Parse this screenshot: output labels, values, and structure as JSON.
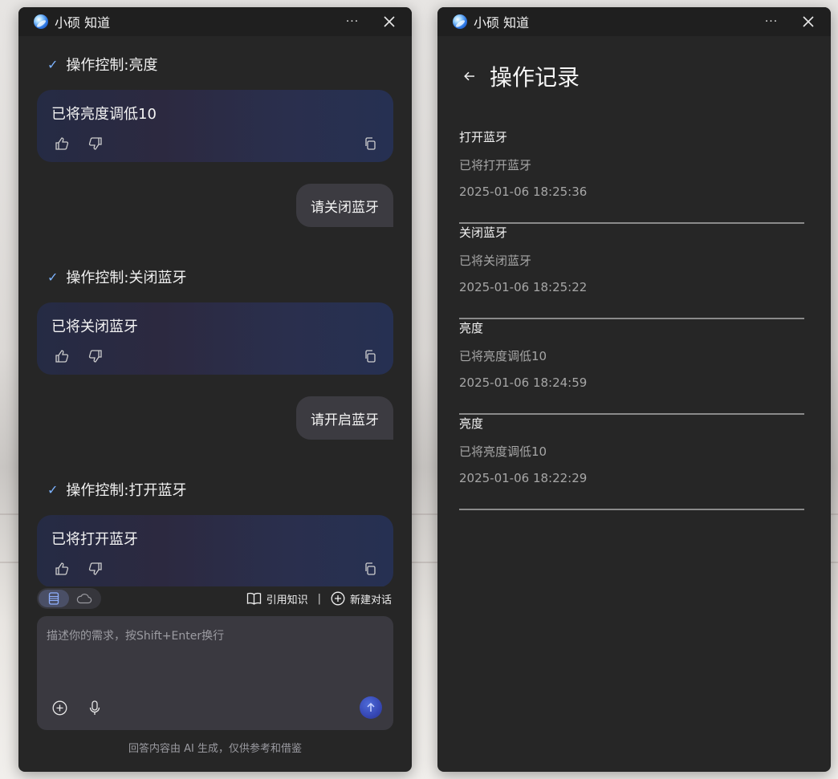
{
  "app": {
    "title": "小硕 知道"
  },
  "chat": {
    "messages": [
      {
        "status": "操作控制:亮度",
        "reply": "已将亮度调低10"
      },
      {
        "user": "请关闭蓝牙"
      },
      {
        "status": "操作控制:关闭蓝牙",
        "reply": "已将关闭蓝牙"
      },
      {
        "user": "请开启蓝牙"
      },
      {
        "status": "操作控制:打开蓝牙",
        "reply": "已将打开蓝牙"
      }
    ],
    "toolbar": {
      "cite_label": "引用知识",
      "separator": "|",
      "new_chat_label": "新建对话"
    },
    "input": {
      "placeholder": "描述你的需求，按Shift+Enter换行",
      "value": ""
    },
    "disclaimer": "回答内容由 AI 生成，仅供参考和借鉴"
  },
  "history": {
    "title": "操作记录",
    "records": [
      {
        "title": "打开蓝牙",
        "desc": "已将打开蓝牙",
        "time": "2025-01-06 18:25:36"
      },
      {
        "title": "关闭蓝牙",
        "desc": "已将关闭蓝牙",
        "time": "2025-01-06 18:25:22"
      },
      {
        "title": "亮度",
        "desc": "已将亮度调低10",
        "time": "2025-01-06 18:24:59"
      },
      {
        "title": "亮度",
        "desc": "已将亮度调低10",
        "time": "2025-01-06 18:22:29"
      }
    ]
  },
  "icons": {
    "more": "more-icon",
    "close": "close-icon",
    "check": "check-icon",
    "thumbs_up": "thumbs-up-icon",
    "thumbs_down": "thumbs-down-icon",
    "copy": "copy-icon",
    "book": "book-icon",
    "plus_circle": "plus-circle-icon",
    "microphone": "microphone-icon",
    "send": "arrow-up-icon",
    "back": "arrow-left-icon",
    "database": "database-icon",
    "cloud": "cloud-icon"
  },
  "colors": {
    "window_bg": "#262626",
    "accent": "#3647b4",
    "check": "#7db3ff"
  }
}
